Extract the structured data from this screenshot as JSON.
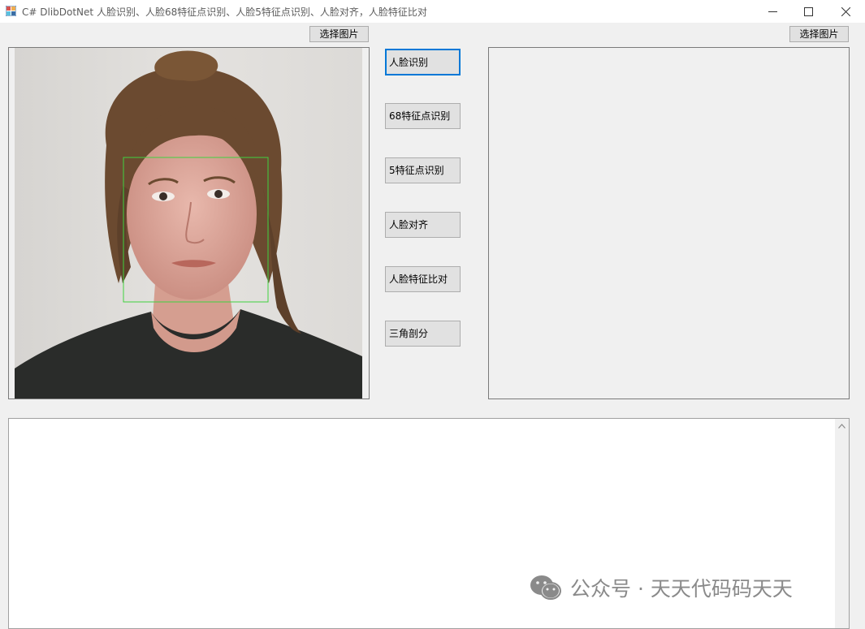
{
  "window": {
    "title": "C# DlibDotNet 人脸识别、人脸68特征点识别、人脸5特征点识别、人脸对齐，人脸特征比对",
    "minimize_icon": "minimize-icon",
    "maximize_icon": "maximize-icon",
    "close_icon": "close-icon"
  },
  "left_panel": {
    "select_button": "选择图片",
    "image_description": "portrait photo",
    "face_box_color": "#3fd23f"
  },
  "right_panel": {
    "select_button": "选择图片"
  },
  "actions": {
    "face_detect": "人脸识别",
    "landmarks_68": "68特征点识别",
    "landmarks_5": "5特征点识别",
    "face_align": "人脸对齐",
    "face_compare": "人脸特征比对",
    "triangulation": "三角剖分"
  },
  "output": {
    "value": ""
  },
  "watermark": {
    "text": "公众号 · 天天代码码天天",
    "icon": "wechat-icon"
  },
  "colors": {
    "accent": "#0078d7",
    "background": "#f0f0f0"
  }
}
